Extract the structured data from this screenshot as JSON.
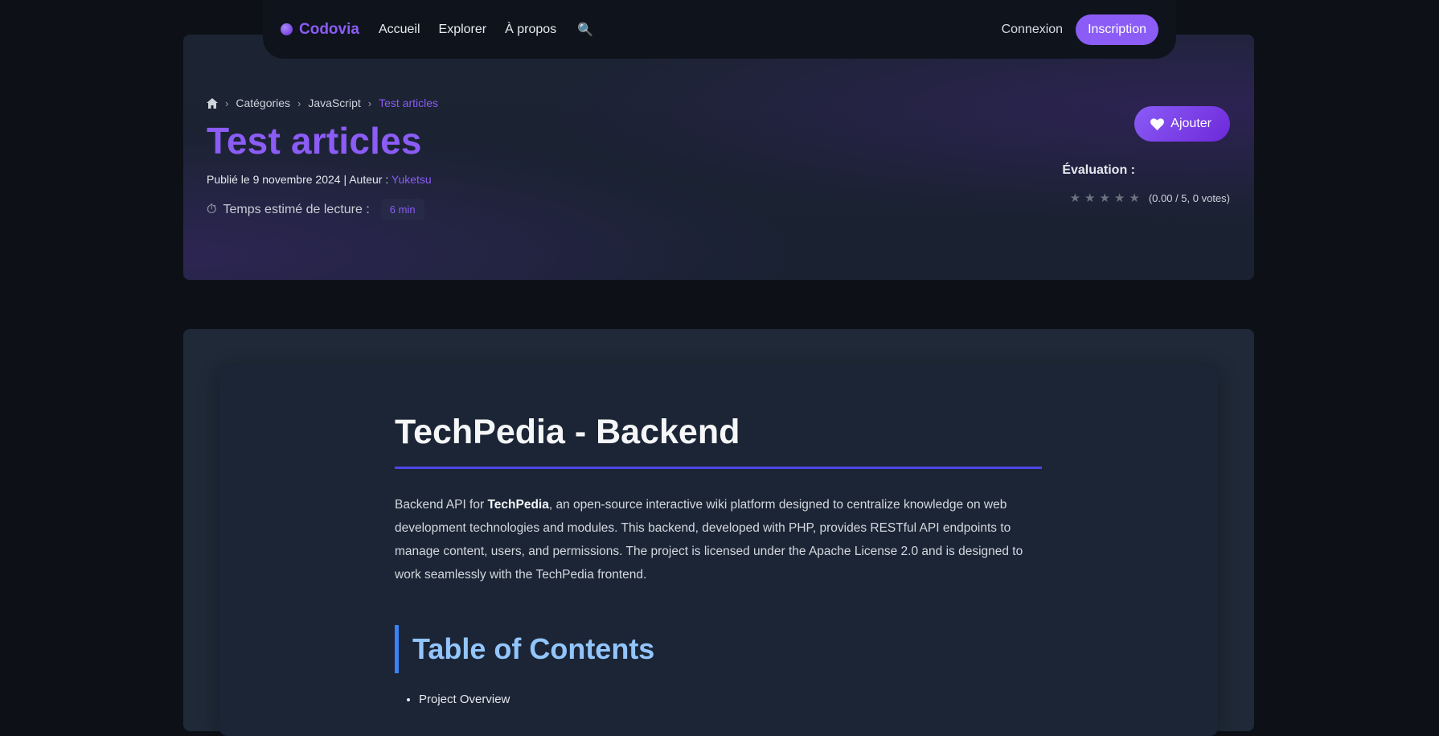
{
  "nav": {
    "brand": "Codovia",
    "links": [
      "Accueil",
      "Explorer",
      "À propos"
    ],
    "search_icon": "magnifier-icon",
    "login": "Connexion",
    "signup": "Inscription"
  },
  "hero": {
    "breadcrumb": [
      "Catégories",
      "JavaScript",
      "Test articles"
    ],
    "title": "Test articles",
    "published": "Publié le 9 novembre 2024 | Auteur : ",
    "author": "Yuketsu",
    "reading_label": "Temps estimé de lecture :",
    "reading_time": "6 min",
    "add_button": "Ajouter",
    "evaluation_label": "Évaluation :",
    "rating_text": "(0.00 / 5, 0 votes)",
    "rating_value": 0,
    "rating_max": 5
  },
  "article": {
    "heading": "TechPedia - Backend",
    "intro_prefix": "Backend API for ",
    "intro_bold": "TechPedia",
    "intro_rest": ", an open-source interactive wiki platform designed to centralize knowledge on web development technologies and modules. This backend, developed with PHP, provides RESTful API endpoints to manage content, users, and permissions. The project is licensed under the Apache License 2.0 and is designed to work seamlessly with the TechPedia frontend.",
    "toc_heading": "Table of Contents",
    "toc_items": [
      "Project Overview"
    ]
  },
  "colors": {
    "accent": "#8b5cf6",
    "page_bg": "#0d1117",
    "toc_border": "#3b82f6",
    "h1_underline": "#4f46e5"
  }
}
